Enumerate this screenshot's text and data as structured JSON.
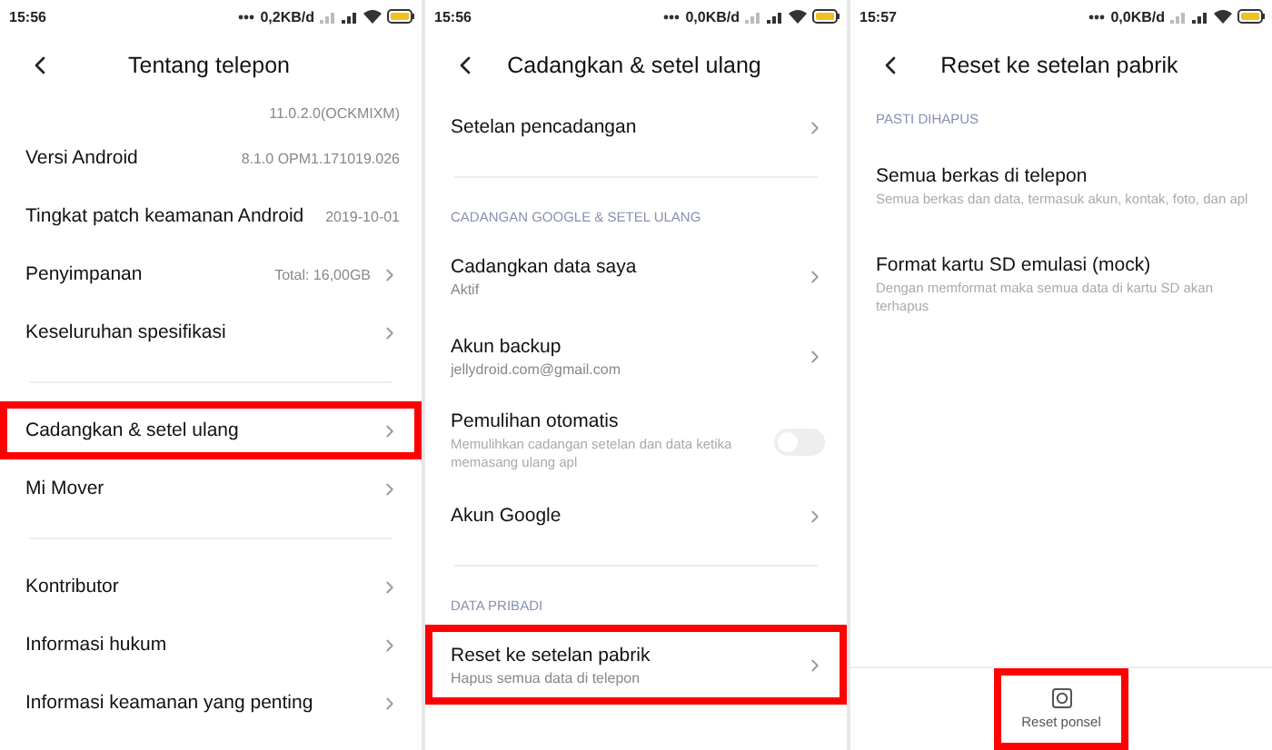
{
  "screens": [
    {
      "status": {
        "time": "15:56",
        "speed": "0,2KB/d"
      },
      "title": "Tentang telepon",
      "items": [
        {
          "kind": "value",
          "value": "11.0.2.0(OCKMIXM)",
          "chevron": false
        },
        {
          "kind": "value",
          "label": "Versi Android",
          "value": "8.1.0 OPM1.171019.026",
          "chevron": false
        },
        {
          "kind": "value",
          "label": "Tingkat patch keamanan Android",
          "value": "2019-10-01",
          "chevron": false
        },
        {
          "kind": "value",
          "label": "Penyimpanan",
          "value": "Total: 16,00GB",
          "chevron": true
        },
        {
          "kind": "nav",
          "label": "Keseluruhan spesifikasi",
          "highlighted": false
        },
        {
          "kind": "divider"
        },
        {
          "kind": "nav",
          "label": "Cadangkan & setel ulang",
          "highlighted": true
        },
        {
          "kind": "nav",
          "label": "Mi Mover",
          "highlighted": false
        },
        {
          "kind": "divider"
        },
        {
          "kind": "nav",
          "label": "Kontributor",
          "highlighted": false
        },
        {
          "kind": "nav",
          "label": "Informasi hukum",
          "highlighted": false
        },
        {
          "kind": "nav",
          "label": "Informasi keamanan yang penting",
          "highlighted": false
        }
      ]
    },
    {
      "status": {
        "time": "15:56",
        "speed": "0,0KB/d"
      },
      "title": "Cadangkan & setel ulang",
      "items": [
        {
          "kind": "nav",
          "label": "Setelan pencadangan",
          "highlighted": false
        },
        {
          "kind": "divider"
        },
        {
          "kind": "section",
          "label": "CADANGAN GOOGLE & SETEL ULANG"
        },
        {
          "kind": "nav",
          "label": "Cadangkan data saya",
          "subtitle": "Aktif",
          "highlighted": false
        },
        {
          "kind": "nav",
          "label": "Akun backup",
          "subtitle": "jellydroid.com@gmail.com",
          "highlighted": false
        },
        {
          "kind": "toggle",
          "label": "Pemulihan otomatis",
          "subtitle": "Memulihkan cadangan setelan dan data ketika memasang ulang apl",
          "on": false
        },
        {
          "kind": "nav",
          "label": "Akun Google",
          "highlighted": false
        },
        {
          "kind": "divider"
        },
        {
          "kind": "section",
          "label": "DATA PRIBADI"
        },
        {
          "kind": "nav",
          "label": "Reset ke setelan pabrik",
          "subtitle": "Hapus semua data di telepon",
          "highlighted": true
        }
      ]
    },
    {
      "status": {
        "time": "15:57",
        "speed": "0,0KB/d"
      },
      "title": "Reset ke setelan pabrik",
      "items": [
        {
          "kind": "section",
          "label": "PASTI DIHAPUS"
        },
        {
          "kind": "info",
          "label": "Semua berkas di telepon",
          "subtitle": "Semua berkas dan data, termasuk akun, kontak, foto, dan apl"
        },
        {
          "kind": "info",
          "label": "Format kartu SD emulasi (mock)",
          "subtitle": "Dengan memformat maka semua data di kartu SD akan terhapus"
        }
      ],
      "footer_button": {
        "label": "Reset ponsel",
        "highlighted": true
      }
    }
  ]
}
